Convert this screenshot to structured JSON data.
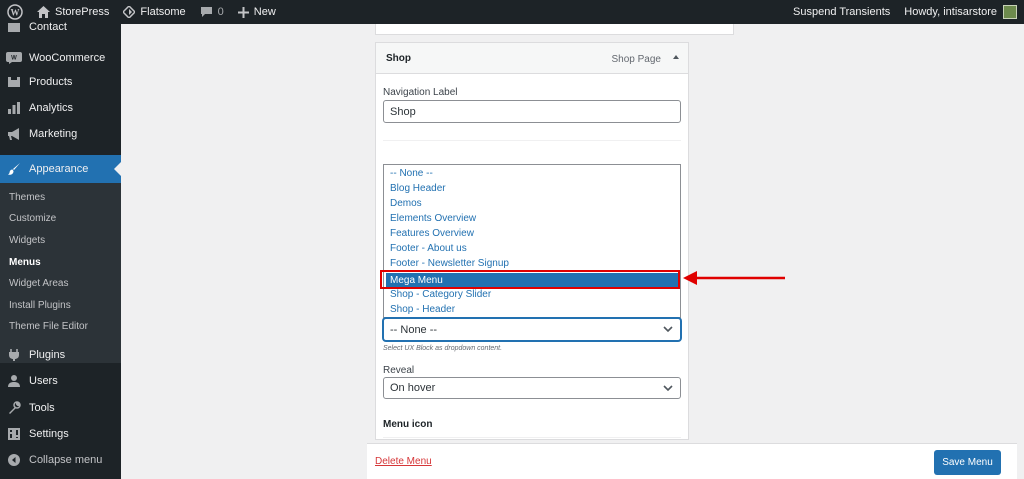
{
  "adminbar": {
    "site_name": "StorePress",
    "theme_name": "Flatsome",
    "comments_count": "0",
    "new_label": "New",
    "suspend_label": "Suspend Transients",
    "howdy_label": "Howdy, intisarstore"
  },
  "sidebar": {
    "cut_item": "Contact",
    "items": [
      {
        "label": "WooCommerce",
        "icon": "woocommerce-icon"
      },
      {
        "label": "Products",
        "icon": "products-icon"
      },
      {
        "label": "Analytics",
        "icon": "analytics-icon"
      },
      {
        "label": "Marketing",
        "icon": "megaphone-icon"
      },
      {
        "label": "Appearance",
        "icon": "paintbrush-icon"
      }
    ],
    "submenu": [
      "Themes",
      "Customize",
      "Widgets",
      "Menus",
      "Widget Areas",
      "Install Plugins",
      "Theme File Editor"
    ],
    "lower_items": [
      {
        "label": "Plugins",
        "icon": "plugins-icon"
      },
      {
        "label": "Users",
        "icon": "users-icon"
      },
      {
        "label": "Tools",
        "icon": "tools-icon"
      },
      {
        "label": "Settings",
        "icon": "settings-icon"
      }
    ],
    "collapse_label": "Collapse menu"
  },
  "menu_item": {
    "title": "Shop",
    "type": "Shop Page",
    "nav_label_caption": "Navigation Label",
    "nav_label_value": "Shop",
    "dropdown_options": [
      "-- None --",
      "Blog Header",
      "Demos",
      "Elements Overview",
      "Features Overview",
      "Footer - About us",
      "Footer - Newsletter Signup",
      "Mega Menu",
      "Shop - Category Slider",
      "Shop - Header"
    ],
    "selected_option": "Mega Menu",
    "ux_block_value": "-- None --",
    "ux_block_help": "Select UX Block as dropdown content.",
    "reveal_caption": "Reveal",
    "reveal_value": "On hover",
    "menu_icon_caption": "Menu icon"
  },
  "footer": {
    "delete_label": "Delete Menu",
    "save_label": "Save Menu"
  },
  "colors": {
    "admin_bar": "#1d2327",
    "accent": "#2271b1",
    "highlight_box": "#e00000",
    "delete_link": "#d63638"
  }
}
